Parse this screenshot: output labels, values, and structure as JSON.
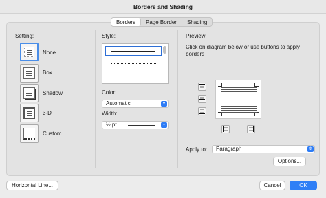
{
  "window": {
    "title": "Borders and Shading"
  },
  "tabs": [
    {
      "label": "Borders"
    },
    {
      "label": "Page Border"
    },
    {
      "label": "Shading"
    }
  ],
  "setting": {
    "label": "Setting:",
    "options": [
      {
        "label": "None"
      },
      {
        "label": "Box"
      },
      {
        "label": "Shadow"
      },
      {
        "label": "3-D"
      },
      {
        "label": "Custom"
      }
    ]
  },
  "style": {
    "label": "Style:",
    "lines": [
      "solid",
      "dotted",
      "dashed"
    ]
  },
  "color": {
    "label": "Color:",
    "value": "Automatic"
  },
  "width": {
    "label": "Width:",
    "value": "½ pt"
  },
  "preview": {
    "label": "Preview",
    "instructions": "Click on diagram below or use buttons to apply borders"
  },
  "apply_to": {
    "label": "Apply to:",
    "value": "Paragraph"
  },
  "buttons": {
    "options": "Options...",
    "horizontal_line": "Horizontal Line...",
    "cancel": "Cancel",
    "ok": "OK"
  },
  "colors": {
    "accent": "#2f7ff6",
    "selection": "#4a8ee8"
  }
}
